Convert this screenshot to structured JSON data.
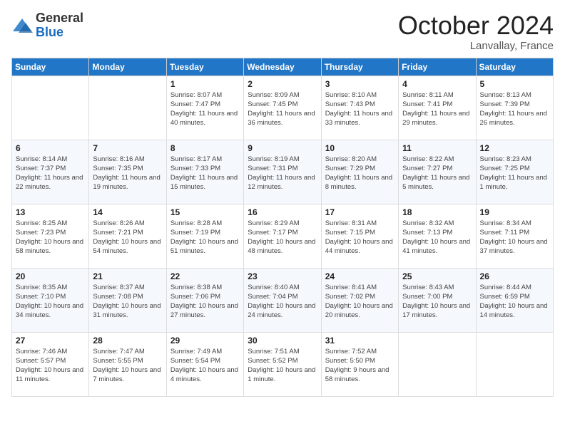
{
  "header": {
    "logo_general": "General",
    "logo_blue": "Blue",
    "month_title": "October 2024",
    "location": "Lanvallay, France"
  },
  "days_of_week": [
    "Sunday",
    "Monday",
    "Tuesday",
    "Wednesday",
    "Thursday",
    "Friday",
    "Saturday"
  ],
  "weeks": [
    [
      {
        "day": "",
        "detail": ""
      },
      {
        "day": "",
        "detail": ""
      },
      {
        "day": "1",
        "detail": "Sunrise: 8:07 AM\nSunset: 7:47 PM\nDaylight: 11 hours and 40 minutes."
      },
      {
        "day": "2",
        "detail": "Sunrise: 8:09 AM\nSunset: 7:45 PM\nDaylight: 11 hours and 36 minutes."
      },
      {
        "day": "3",
        "detail": "Sunrise: 8:10 AM\nSunset: 7:43 PM\nDaylight: 11 hours and 33 minutes."
      },
      {
        "day": "4",
        "detail": "Sunrise: 8:11 AM\nSunset: 7:41 PM\nDaylight: 11 hours and 29 minutes."
      },
      {
        "day": "5",
        "detail": "Sunrise: 8:13 AM\nSunset: 7:39 PM\nDaylight: 11 hours and 26 minutes."
      }
    ],
    [
      {
        "day": "6",
        "detail": "Sunrise: 8:14 AM\nSunset: 7:37 PM\nDaylight: 11 hours and 22 minutes."
      },
      {
        "day": "7",
        "detail": "Sunrise: 8:16 AM\nSunset: 7:35 PM\nDaylight: 11 hours and 19 minutes."
      },
      {
        "day": "8",
        "detail": "Sunrise: 8:17 AM\nSunset: 7:33 PM\nDaylight: 11 hours and 15 minutes."
      },
      {
        "day": "9",
        "detail": "Sunrise: 8:19 AM\nSunset: 7:31 PM\nDaylight: 11 hours and 12 minutes."
      },
      {
        "day": "10",
        "detail": "Sunrise: 8:20 AM\nSunset: 7:29 PM\nDaylight: 11 hours and 8 minutes."
      },
      {
        "day": "11",
        "detail": "Sunrise: 8:22 AM\nSunset: 7:27 PM\nDaylight: 11 hours and 5 minutes."
      },
      {
        "day": "12",
        "detail": "Sunrise: 8:23 AM\nSunset: 7:25 PM\nDaylight: 11 hours and 1 minute."
      }
    ],
    [
      {
        "day": "13",
        "detail": "Sunrise: 8:25 AM\nSunset: 7:23 PM\nDaylight: 10 hours and 58 minutes."
      },
      {
        "day": "14",
        "detail": "Sunrise: 8:26 AM\nSunset: 7:21 PM\nDaylight: 10 hours and 54 minutes."
      },
      {
        "day": "15",
        "detail": "Sunrise: 8:28 AM\nSunset: 7:19 PM\nDaylight: 10 hours and 51 minutes."
      },
      {
        "day": "16",
        "detail": "Sunrise: 8:29 AM\nSunset: 7:17 PM\nDaylight: 10 hours and 48 minutes."
      },
      {
        "day": "17",
        "detail": "Sunrise: 8:31 AM\nSunset: 7:15 PM\nDaylight: 10 hours and 44 minutes."
      },
      {
        "day": "18",
        "detail": "Sunrise: 8:32 AM\nSunset: 7:13 PM\nDaylight: 10 hours and 41 minutes."
      },
      {
        "day": "19",
        "detail": "Sunrise: 8:34 AM\nSunset: 7:11 PM\nDaylight: 10 hours and 37 minutes."
      }
    ],
    [
      {
        "day": "20",
        "detail": "Sunrise: 8:35 AM\nSunset: 7:10 PM\nDaylight: 10 hours and 34 minutes."
      },
      {
        "day": "21",
        "detail": "Sunrise: 8:37 AM\nSunset: 7:08 PM\nDaylight: 10 hours and 31 minutes."
      },
      {
        "day": "22",
        "detail": "Sunrise: 8:38 AM\nSunset: 7:06 PM\nDaylight: 10 hours and 27 minutes."
      },
      {
        "day": "23",
        "detail": "Sunrise: 8:40 AM\nSunset: 7:04 PM\nDaylight: 10 hours and 24 minutes."
      },
      {
        "day": "24",
        "detail": "Sunrise: 8:41 AM\nSunset: 7:02 PM\nDaylight: 10 hours and 20 minutes."
      },
      {
        "day": "25",
        "detail": "Sunrise: 8:43 AM\nSunset: 7:00 PM\nDaylight: 10 hours and 17 minutes."
      },
      {
        "day": "26",
        "detail": "Sunrise: 8:44 AM\nSunset: 6:59 PM\nDaylight: 10 hours and 14 minutes."
      }
    ],
    [
      {
        "day": "27",
        "detail": "Sunrise: 7:46 AM\nSunset: 5:57 PM\nDaylight: 10 hours and 11 minutes."
      },
      {
        "day": "28",
        "detail": "Sunrise: 7:47 AM\nSunset: 5:55 PM\nDaylight: 10 hours and 7 minutes."
      },
      {
        "day": "29",
        "detail": "Sunrise: 7:49 AM\nSunset: 5:54 PM\nDaylight: 10 hours and 4 minutes."
      },
      {
        "day": "30",
        "detail": "Sunrise: 7:51 AM\nSunset: 5:52 PM\nDaylight: 10 hours and 1 minute."
      },
      {
        "day": "31",
        "detail": "Sunrise: 7:52 AM\nSunset: 5:50 PM\nDaylight: 9 hours and 58 minutes."
      },
      {
        "day": "",
        "detail": ""
      },
      {
        "day": "",
        "detail": ""
      }
    ]
  ]
}
